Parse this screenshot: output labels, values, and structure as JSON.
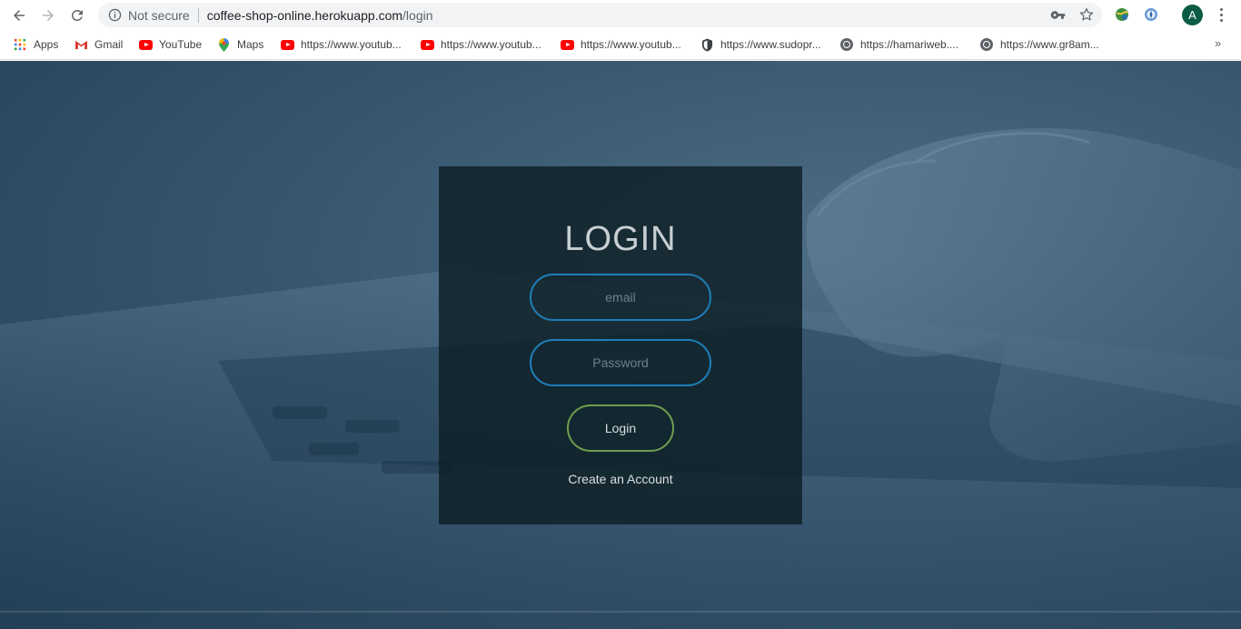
{
  "browser": {
    "security_text": "Not secure",
    "url_host": "coffee-shop-online.herokuapp.com",
    "url_path": "/login",
    "profile_initial": "A"
  },
  "bookmarks": [
    {
      "label": "Apps",
      "icon": "apps-grid-icon"
    },
    {
      "label": "Gmail",
      "icon": "gmail-icon"
    },
    {
      "label": "YouTube",
      "icon": "youtube-icon"
    },
    {
      "label": "Maps",
      "icon": "maps-pin-icon"
    },
    {
      "label": "https://www.youtub...",
      "icon": "youtube-icon"
    },
    {
      "label": "https://www.youtub...",
      "icon": "youtube-icon"
    },
    {
      "label": "https://www.youtub...",
      "icon": "youtube-icon"
    },
    {
      "label": "https://www.sudopr...",
      "icon": "shield-icon"
    },
    {
      "label": "https://hamariweb....",
      "icon": "globe-icon"
    },
    {
      "label": "https://www.gr8am...",
      "icon": "globe-icon"
    }
  ],
  "bookmarks_overflow": "»",
  "login": {
    "title": "LOGIN",
    "email_placeholder": "email",
    "password_placeholder": "Password",
    "button_label": "Login",
    "create_account_label": "Create an Account"
  },
  "colors": {
    "input_border": "#1e7fb8",
    "button_border": "#6f9e4f",
    "box_background": "#0e1e24"
  }
}
